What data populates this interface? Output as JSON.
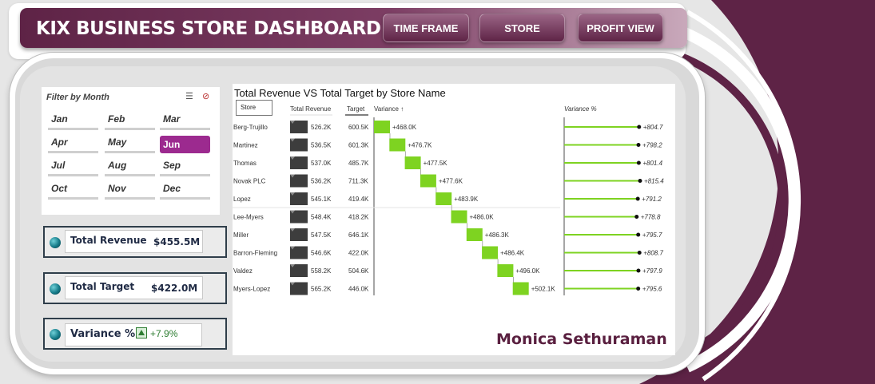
{
  "header": {
    "title": "KIX BUSINESS STORE DASHBOARD",
    "buttons": [
      "TIME FRAME",
      "STORE",
      "PROFIT VIEW"
    ]
  },
  "slicer": {
    "title": "Filter by Month",
    "months": [
      "Jan",
      "Feb",
      "Mar",
      "Apr",
      "May",
      "Jun",
      "Jul",
      "Aug",
      "Sep",
      "Oct",
      "Nov",
      "Dec"
    ],
    "selected": "Jun"
  },
  "kpis": {
    "revenue": {
      "label": "Total Revenue",
      "value": "$455.5M"
    },
    "target": {
      "label": "Total Target",
      "value": "$422.0M"
    },
    "variance": {
      "label": "Variance %",
      "value": "+7.9%"
    }
  },
  "colors": {
    "brand": "#5e2346",
    "accent": "#9c2a8f",
    "variance_bar": "#7ed321",
    "revenue_bar": "#3d3d3d"
  },
  "chart_data": {
    "type": "table",
    "title": "Total Revenue VS Total Target by Store Name",
    "columns": [
      "Store",
      "Total Revenue",
      "Target",
      "Variance ↑",
      "Variance %"
    ],
    "stores": [
      "Berg-Trujillo",
      "Martinez",
      "Thomas",
      "Novak PLC",
      "Lopez",
      "Lee-Myers",
      "Miller",
      "Barron-Fleming",
      "Valdez",
      "Myers-Lopez"
    ],
    "revenue": [
      526.2,
      536.5,
      537.0,
      536.2,
      545.1,
      548.4,
      547.5,
      546.6,
      558.2,
      565.2
    ],
    "revenue_labels": [
      "526.2K",
      "536.5K",
      "537.0K",
      "536.2K",
      "545.1K",
      "548.4K",
      "547.5K",
      "546.6K",
      "558.2K",
      "565.2K"
    ],
    "target": [
      600.5,
      601.3,
      485.7,
      711.3,
      419.4,
      418.2,
      646.1,
      422.0,
      504.6,
      446.0
    ],
    "target_labels": [
      "600.5K",
      "601.3K",
      "485.7K",
      "711.3K",
      "419.4K",
      "418.2K",
      "646.1K",
      "422.0K",
      "504.6K",
      "446.0K"
    ],
    "variance": [
      468.0,
      476.7,
      477.5,
      477.6,
      483.9,
      486.0,
      486.3,
      486.4,
      496.0,
      502.1
    ],
    "variance_labels": [
      "+468.0K",
      "+476.7K",
      "+477.5K",
      "+477.6K",
      "+483.9K",
      "+486.0K",
      "+486.3K",
      "+486.4K",
      "+496.0K",
      "+502.1K"
    ],
    "variance_pct": [
      804.7,
      798.2,
      801.4,
      815.4,
      791.2,
      778.8,
      795.7,
      808.7,
      797.9,
      795.6
    ],
    "variance_pct_labels": [
      "+804.7",
      "+798.2",
      "+801.4",
      "+815.4",
      "+791.2",
      "+778.8",
      "+795.7",
      "+808.7",
      "+797.9",
      "+795.6"
    ]
  },
  "signature": "Monica Sethuraman"
}
